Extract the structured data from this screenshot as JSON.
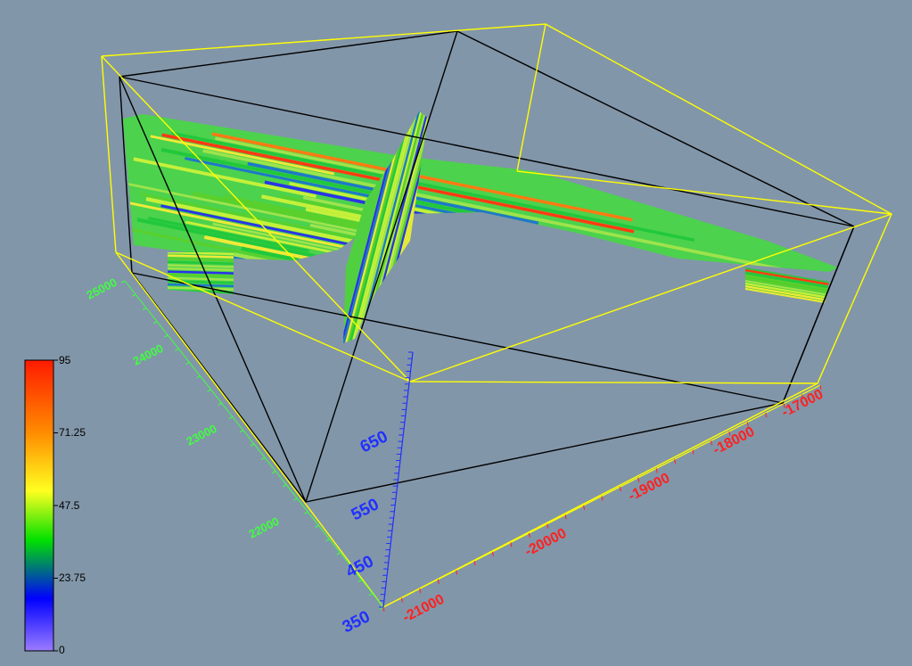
{
  "legend": {
    "labels": [
      "95",
      "71.25",
      "47.5",
      "23.75",
      "0"
    ],
    "min": 0,
    "max": 95,
    "stops": [
      "#ff1a00",
      "#ff8c00",
      "#ffff20",
      "#00e000",
      "#0000ff",
      "#9b7cff"
    ]
  },
  "axes": {
    "y_ticks": [
      "25000",
      "24000",
      "23000",
      "22000"
    ],
    "x_ticks": [
      "-21000",
      "-20000",
      "-19000",
      "-18000",
      "-17000"
    ],
    "z_ticks": [
      "350",
      "450",
      "550",
      "650"
    ]
  },
  "colors": {
    "background": "#8296a9",
    "bounding_box": "#ffff00",
    "inner_box": "#000000",
    "y_axis": "#40ff40",
    "x_axis": "#ff2020",
    "z_axis": "#2030ff"
  }
}
